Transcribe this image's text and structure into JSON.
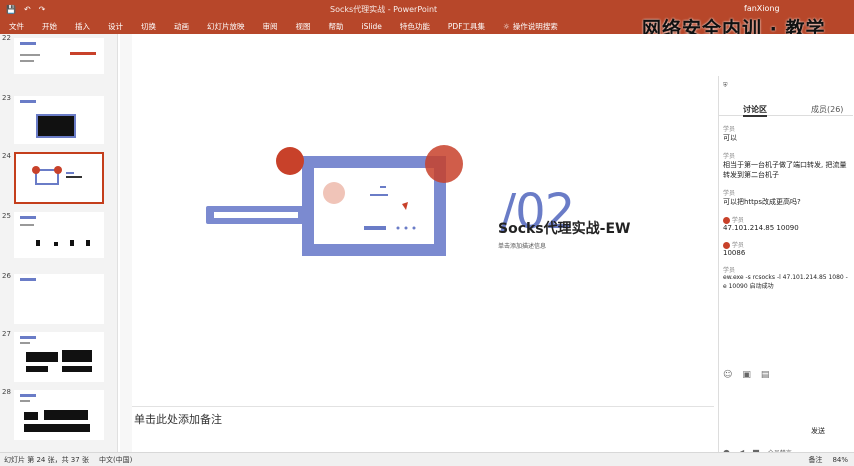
{
  "window": {
    "doc_title": "Socks代理实战 - PowerPoint",
    "user": "fanXiong",
    "quick_access": [
      "save-icon",
      "undo-icon",
      "redo-icon"
    ]
  },
  "overlay": {
    "title": "网络安全内训 · 教学"
  },
  "ribbon": {
    "tabs": [
      "文件",
      "开始",
      "插入",
      "设计",
      "切换",
      "动画",
      "幻灯片放映",
      "审阅",
      "视图",
      "帮助",
      "iSlide",
      "特色功能",
      "PDF工具集"
    ],
    "search_label": "操作说明搜索"
  },
  "thumbnails": [
    {
      "num": "22",
      "selected": false
    },
    {
      "num": "23",
      "selected": false
    },
    {
      "num": "24",
      "selected": true
    },
    {
      "num": "25",
      "selected": false
    },
    {
      "num": "26",
      "selected": false
    },
    {
      "num": "27",
      "selected": false
    },
    {
      "num": "28",
      "selected": false
    }
  ],
  "slide": {
    "heading": "/02",
    "title": "Socks代理实战-EW",
    "subtitle": "单击添加描述信息"
  },
  "notes": {
    "placeholder": "单击此处添加备注"
  },
  "chat": {
    "header": "讨论区",
    "tab_members": "成员(26)",
    "messages": [
      {
        "name": "学员",
        "text": "可以"
      },
      {
        "name": "学员",
        "text": "相当于第一台机子做了端口转发, 把流量转发到第二台机子"
      },
      {
        "name": "学员",
        "text": "可以把https改成更高吗?"
      },
      {
        "name": "学员",
        "text": "47.101.214.85 10090"
      },
      {
        "name": "学员",
        "text": "10086"
      },
      {
        "name": "学员",
        "text": "ew.exe -s rcsocks -l 47.101.214.85 1080 -e 10090 启动成功"
      }
    ],
    "input_label": "发送",
    "mic_label": "全员禁言"
  },
  "status": {
    "slide_info": "幻灯片 第 24 张，共 37 张",
    "lang": "中文(中国)",
    "notes_btn": "备注",
    "zoom": "84%"
  },
  "colors": {
    "ribbon": "#b7472a",
    "accent_blue": "#6a7cc7",
    "accent_red": "#c8412a"
  }
}
